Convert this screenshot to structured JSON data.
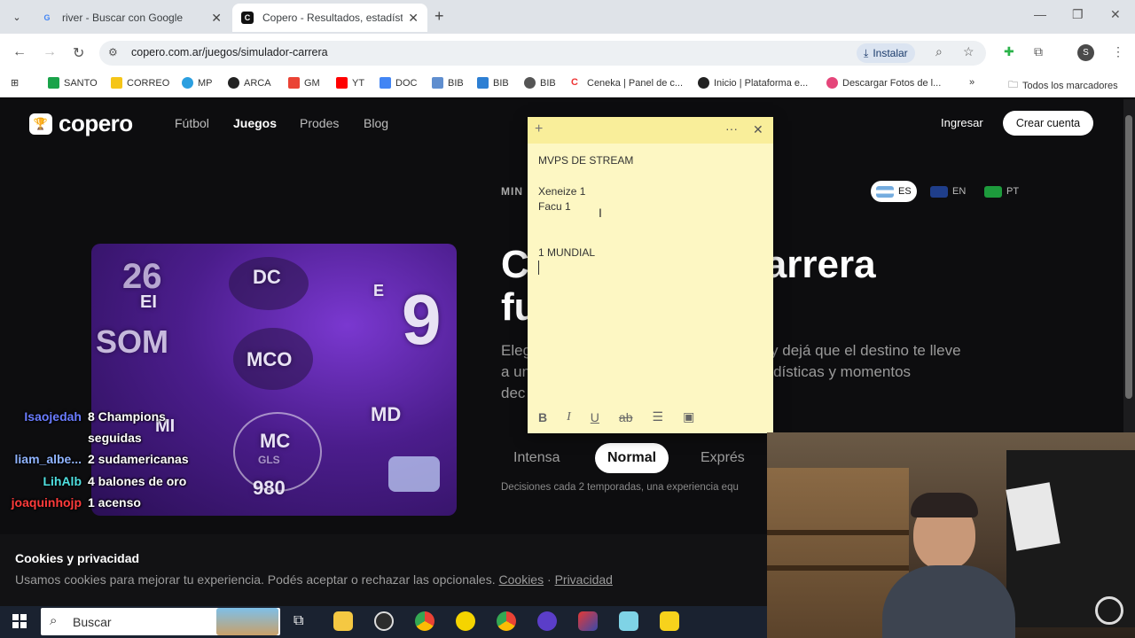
{
  "browser": {
    "tabs": [
      {
        "title": "river - Buscar con Google",
        "favicon": "G",
        "active": false
      },
      {
        "title": "Copero - Resultados, estadísti...",
        "favicon": "C",
        "active": true
      }
    ],
    "url": "copero.com.ar/juegos/simulador-carrera",
    "install_label": "Instalar",
    "profile_initial": "S",
    "bookmarks": [
      "SANTO",
      "CORREO",
      "MP",
      "ARCA",
      "GM",
      "YT",
      "DOC",
      "BIB",
      "BIB",
      "BIB",
      "Ceneka | Panel de c...",
      "Inicio | Plataforma e...",
      "Descargar Fotos de l..."
    ],
    "all_bookmarks_label": "Todos los marcadores"
  },
  "site": {
    "logo": "copero",
    "nav": [
      "Fútbol",
      "Juegos",
      "Prodes",
      "Blog"
    ],
    "login": "Ingresar",
    "signup": "Crear cuenta",
    "mini_label": "MIN",
    "languages": [
      "ES",
      "EN",
      "PT"
    ],
    "hero_title_1": "C",
    "hero_title_1b": "arrera",
    "hero_title_2": "fu",
    "hero_sub_1": "Eleg",
    "hero_sub_1b": "y dejá que el destino te lleve",
    "hero_sub_2": "a un",
    "hero_sub_2b": "dísticas y momentos",
    "hero_sub_3": "dec",
    "modes": [
      "Intensa",
      "Normal",
      "Exprés"
    ],
    "mode_desc": "Decisiones cada 2 temporadas, una experiencia equ",
    "image_positions": [
      "26",
      "EI",
      "DC",
      "E",
      "9",
      "SOM",
      "MCO",
      "MD",
      "MI",
      "MC",
      "GLS",
      "980"
    ]
  },
  "cookie": {
    "title": "Cookies y privacidad",
    "text": "Usamos cookies para mejorar tu experiencia. Podés aceptar o rechazar las opcionales.",
    "link1": "Cookies",
    "sep": "·",
    "link2": "Privacidad"
  },
  "sticky_note": {
    "lines": [
      "MVPS DE STREAM",
      "Xeneize 1",
      "Facu 1",
      "1 MUNDIAL"
    ]
  },
  "chat_overlay": [
    {
      "user": "Isaojedah",
      "message": "8 Champions",
      "color": "#6a7cff"
    },
    {
      "user": "",
      "message": "seguidas",
      "color": "#ffffff"
    },
    {
      "user": "liam_albe...",
      "message": "2 sudamericanas",
      "color": "#8fb3ff"
    },
    {
      "user": "LihAlb",
      "message": "4 balones de oro",
      "color": "#4fe0e0"
    },
    {
      "user": "joaquinhojp",
      "message": "1 acenso",
      "color": "#ff3b3b"
    }
  ],
  "taskbar": {
    "search_placeholder": "Buscar"
  }
}
